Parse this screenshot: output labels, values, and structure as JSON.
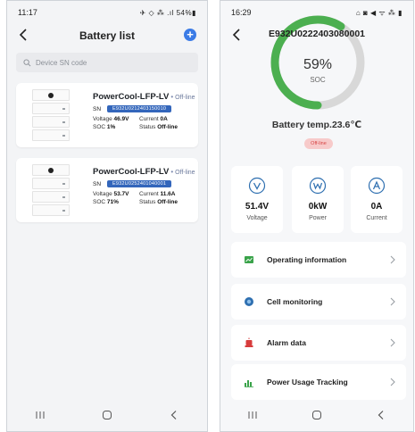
{
  "left_screen": {
    "status_bar": {
      "time": "11:17",
      "indicators": "◀ ◙ ⌂ •",
      "right": "✈ ◇ ⁂ .ıl 54%▮"
    },
    "title": "Battery list",
    "add_label": "+",
    "search": {
      "placeholder": "Device SN code"
    },
    "devices": [
      {
        "name": "PowerCool-LFP-LV",
        "separator": "•",
        "status": "Off-line",
        "sn_label": "SN",
        "sn": "E932U0212403150010",
        "voltage_label": "Voltage",
        "voltage": "46.9V",
        "current_label": "Current",
        "current": "0A",
        "soc_label": "SOC",
        "soc": "1%",
        "status_label": "Status",
        "status_value": "Off-line"
      },
      {
        "name": "PowerCool-LFP-LV",
        "separator": "•",
        "status": "Off-line",
        "sn_label": "SN",
        "sn": "E932U0252401040001",
        "voltage_label": "Voltage",
        "voltage": "53.7V",
        "current_label": "Current",
        "current": "11.6A",
        "soc_label": "SOC",
        "soc": "71%",
        "status_label": "Status",
        "status_value": "Off-line"
      }
    ]
  },
  "right_screen": {
    "status_bar": {
      "time": "16:29",
      "right": "⌂ ◙ ◀ ᯤ ⁂ ▮"
    },
    "title": "E932U0222403080001",
    "soc": {
      "value": "59%",
      "label": "SOC",
      "fraction": 0.59,
      "color": "#4caf50",
      "track_color": "#d8d8d8"
    },
    "temperature": "Battery temp.23.6℃",
    "status_chip": "Off-line",
    "metrics": [
      {
        "icon": "voltage-icon",
        "value": "51.4V",
        "label": "Voltage"
      },
      {
        "icon": "power-icon",
        "value": "0kW",
        "label": "Power"
      },
      {
        "icon": "current-icon",
        "value": "0A",
        "label": "Current"
      }
    ],
    "menu": [
      {
        "icon": "chart-icon",
        "label": "Operating information"
      },
      {
        "icon": "cell-icon",
        "label": "Cell monitoring"
      },
      {
        "icon": "alarm-icon",
        "label": "Alarm data"
      },
      {
        "icon": "usage-icon",
        "label": "Power Usage Tracking"
      }
    ]
  },
  "colors": {
    "accent_blue": "#3b7be6",
    "sn_chip": "#3366bb",
    "offline_red": "#d74444",
    "soc_green": "#4caf50"
  }
}
